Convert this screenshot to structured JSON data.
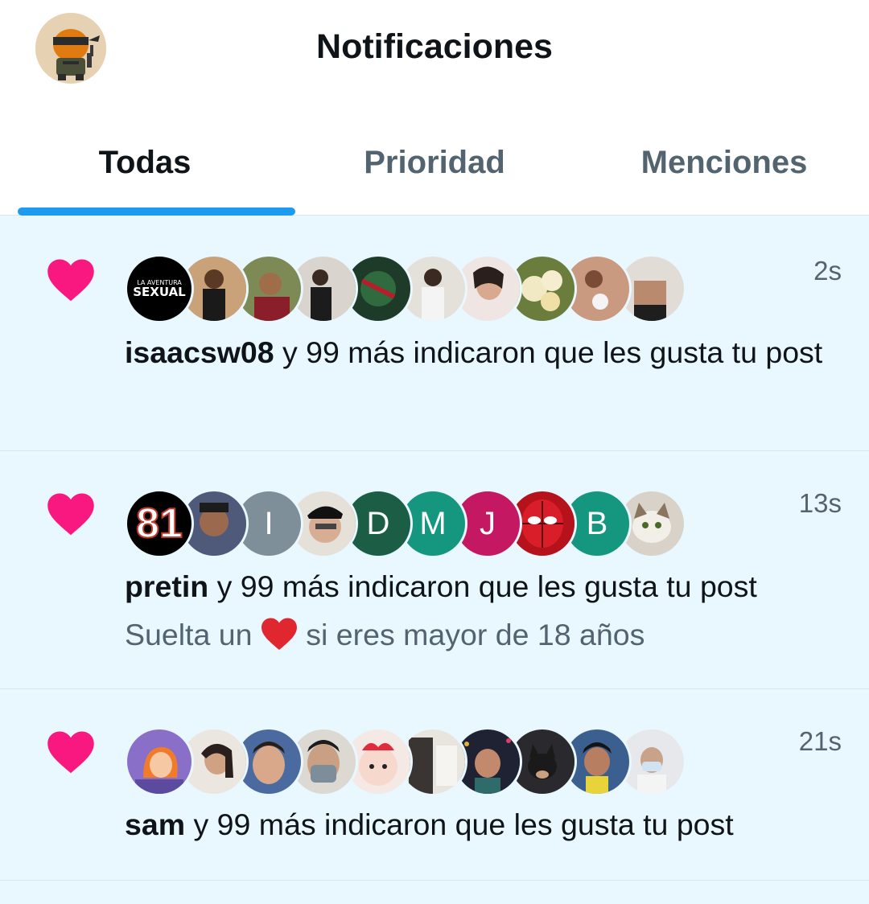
{
  "header": {
    "title": "Notificaciones"
  },
  "tabs": [
    {
      "label": "Todas",
      "active": true
    },
    {
      "label": "Prioridad",
      "active": false
    },
    {
      "label": "Menciones",
      "active": false
    }
  ],
  "colors": {
    "accent": "#1d9bf0",
    "heart": "#f91880",
    "feed_bg": "#e9f7fe",
    "muted": "#536471"
  },
  "notifications": [
    {
      "icon": "heart-icon",
      "time": "2s",
      "user": "isaacsw08",
      "text": " y 99 más indicaron que les gusta tu post",
      "avatar_badge": {
        "line1": "LA AVENTURA",
        "line2": "SEXUAL"
      }
    },
    {
      "icon": "heart-icon",
      "time": "13s",
      "user": "pretin",
      "text": " y 99 más indicaron que les gusta tu post",
      "sub_before": "Suelta un ",
      "sub_after": " si eres mayor de 18 años",
      "avatar_number": "81",
      "avatar_letters": [
        "I",
        "D",
        "M",
        "J",
        "B"
      ]
    },
    {
      "icon": "heart-icon",
      "time": "21s",
      "user": "sam",
      "text": " y 99 más indicaron que les gusta tu post"
    }
  ]
}
